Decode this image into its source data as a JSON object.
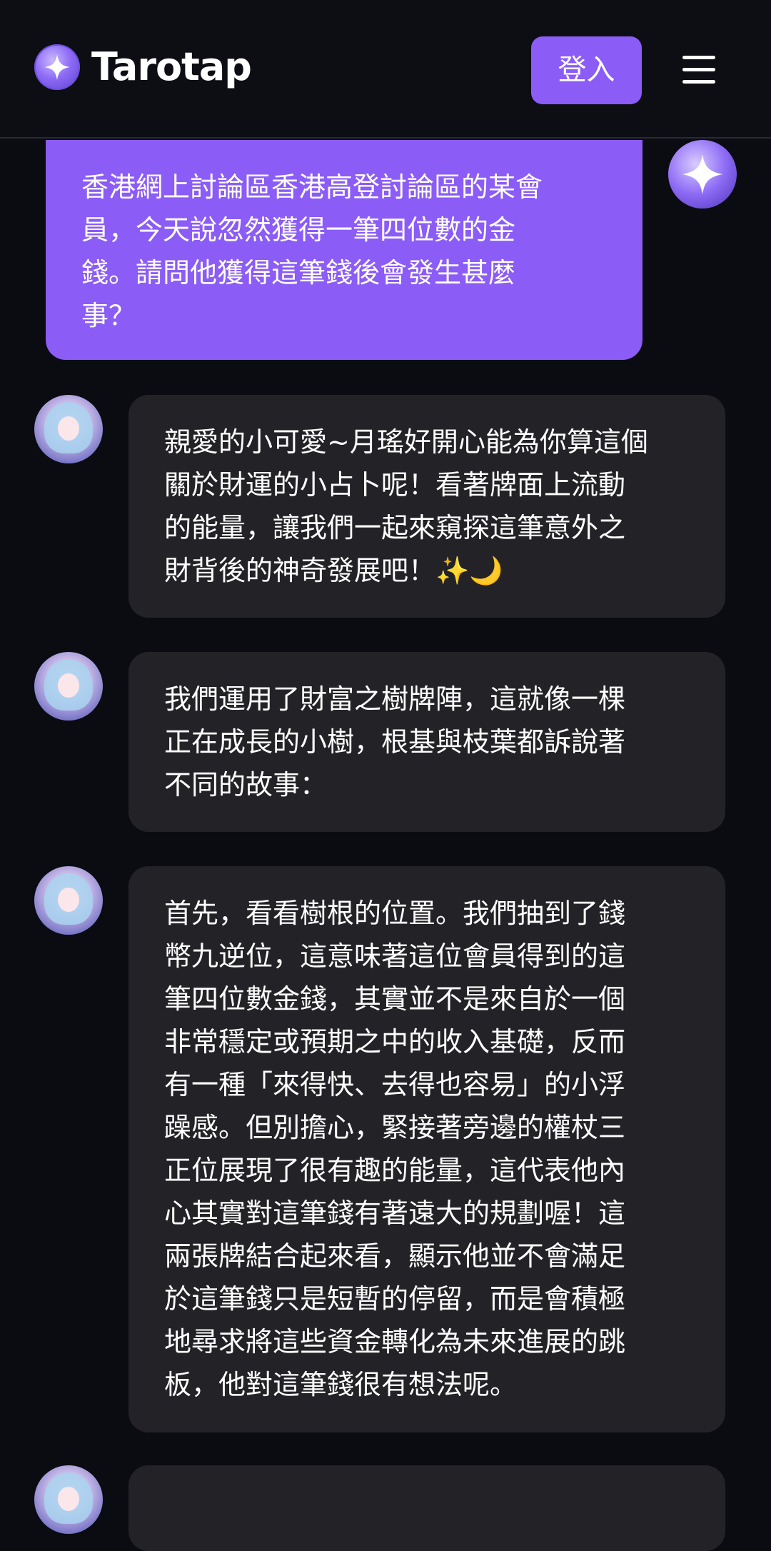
{
  "header": {
    "app_name": "Tarotap",
    "login_label": "登入",
    "logo_icon": "sparkle-star-icon",
    "menu_icon": "hamburger-menu-icon"
  },
  "colors": {
    "accent": "#8b5cf6",
    "background": "#0b0b12",
    "bot_bubble": "#232327"
  },
  "conversation": {
    "user_message": "香港網上討論區香港高登討論區的某會\n員，今天說忽然獲得一筆四位數的金\n錢。請問他獲得這筆錢後會發生甚麼\n事？",
    "bot_messages": [
      "親愛的小可愛~月瑤好開心能為你算這個\n關於財運的小占卜呢！看著牌面上流動\n的能量，讓我們一起來窺探這筆意外之\n財背後的神奇發展吧！✨🌙",
      "我們運用了財富之樹牌陣，這就像一棵\n正在成長的小樹，根基與枝葉都訴說著\n不同的故事：",
      "首先，看看樹根的位置。我們抽到了錢\n幣九逆位，這意味著這位會員得到的這\n筆四位數金錢，其實並不是來自於一個\n非常穩定或預期之中的收入基礎，反而\n有一種「來得快、去得也容易」的小浮\n躁感。但別擔心，緊接著旁邊的權杖三\n正位展現了很有趣的能量，這代表他內\n心其實對這筆錢有著遠大的規劃喔！這\n兩張牌結合起來看，顯示他並不會滿足\n於這筆錢只是短暫的停留，而是會積極\n地尋求將這些資金轉化為未來進展的跳\n板，他對這筆錢很有想法呢。"
    ]
  }
}
